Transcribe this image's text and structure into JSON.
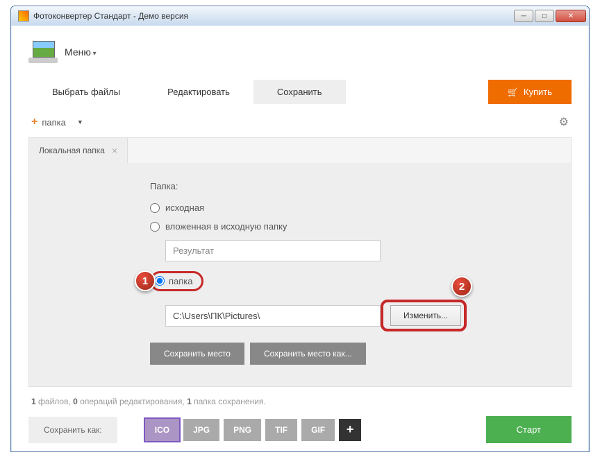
{
  "window": {
    "title": "Фотоконвертер Стандарт - Демо версия"
  },
  "menu": {
    "label": "Меню"
  },
  "tabs": {
    "select": "Выбрать файлы",
    "edit": "Редактировать",
    "save": "Сохранить"
  },
  "buy": {
    "label": "Купить"
  },
  "toolbar": {
    "add_folder": "папка"
  },
  "panel": {
    "tab_label": "Локальная папка",
    "folder_label": "Папка:",
    "radio_source": "исходная",
    "radio_nested": "вложенная в исходную папку",
    "nested_value": "Результат",
    "radio_folder": "папка",
    "path_value": "C:\\Users\\ПК\\Pictures\\",
    "change_btn": "Изменить...",
    "save_place": "Сохранить место",
    "save_place_as": "Сохранить место как..."
  },
  "status": {
    "files_n": "1",
    "files_t": " файлов, ",
    "ops_n": "0",
    "ops_t": " операций редактирования, ",
    "folders_n": "1",
    "folders_t": " папка сохранения."
  },
  "bottom": {
    "save_as": "Сохранить как:",
    "formats": [
      "ICO",
      "JPG",
      "PNG",
      "TIF",
      "GIF"
    ],
    "start": "Старт"
  },
  "callouts": {
    "one": "1",
    "two": "2"
  }
}
